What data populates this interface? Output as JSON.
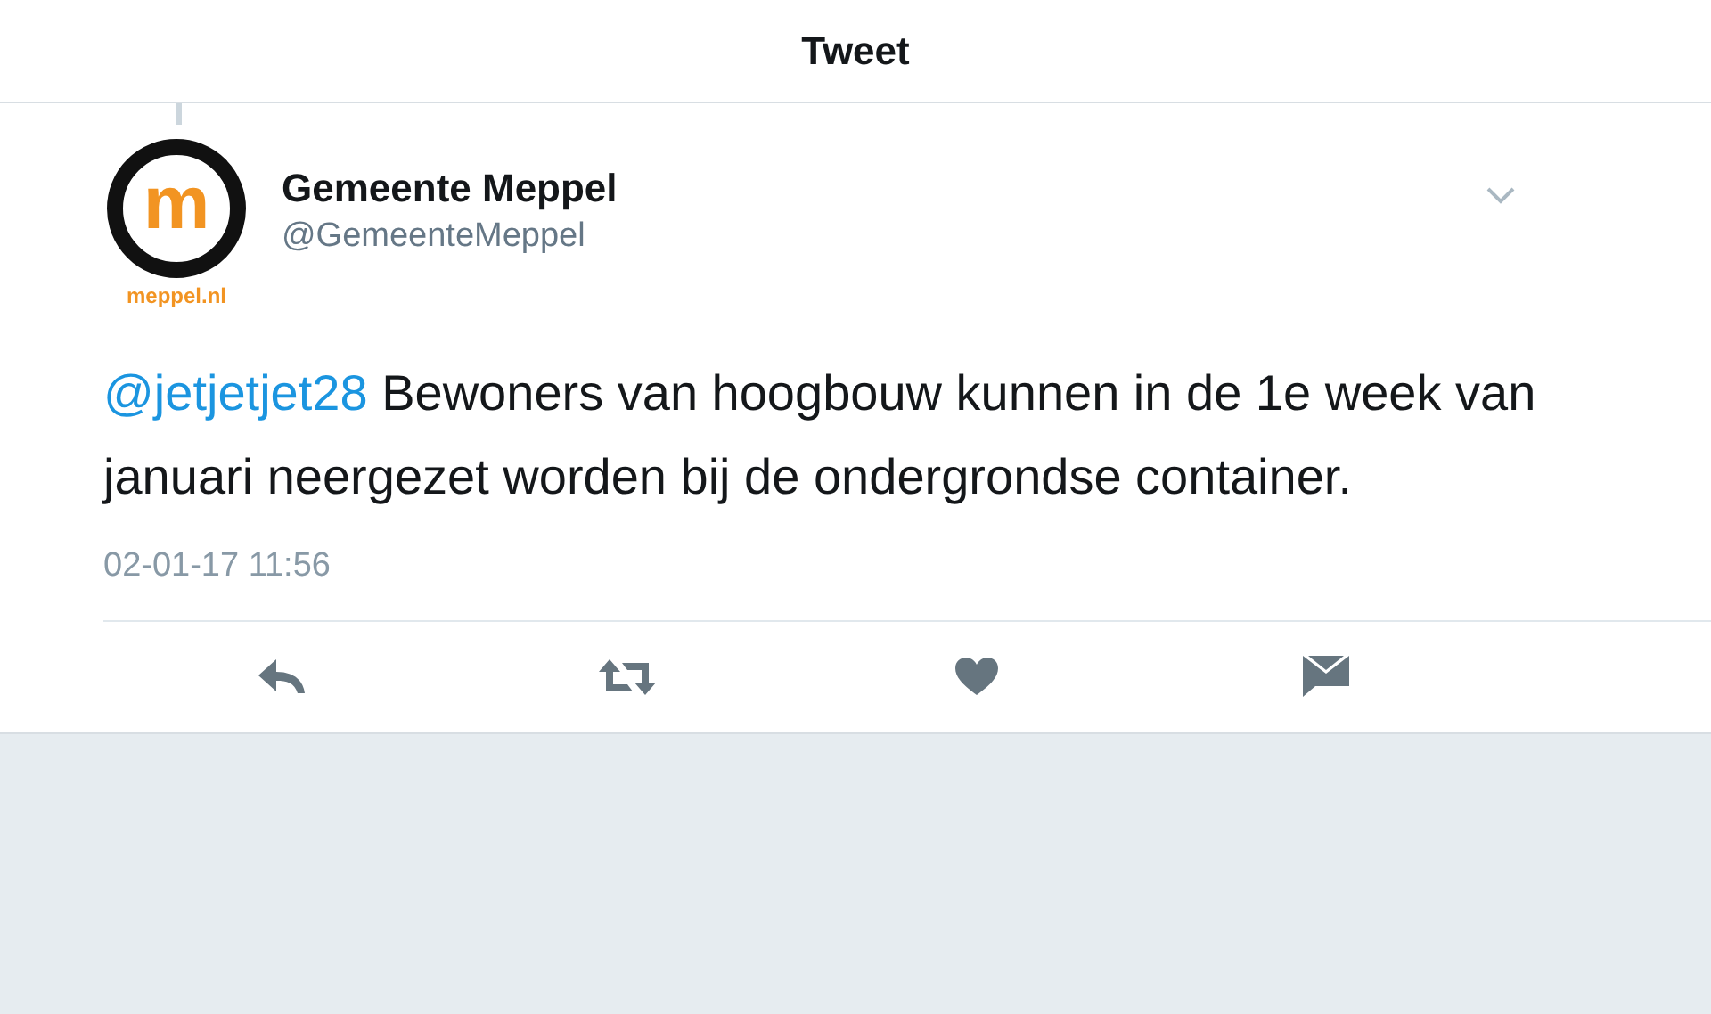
{
  "header": {
    "title": "Tweet"
  },
  "tweet": {
    "avatar": {
      "letter": "m",
      "caption": "meppel.nl"
    },
    "name": "Gemeente Meppel",
    "handle": "@GemeenteMeppel",
    "mention": "@jetjetjet28",
    "text": "Bewoners van hoogbouw kunnen in de 1e week van januari neergezet worden bij de ondergrondse container.",
    "timestamp": "02-01-17 11:56",
    "actions": [
      {
        "kind": "reply"
      },
      {
        "kind": "retweet"
      },
      {
        "kind": "like"
      },
      {
        "kind": "message"
      }
    ]
  }
}
